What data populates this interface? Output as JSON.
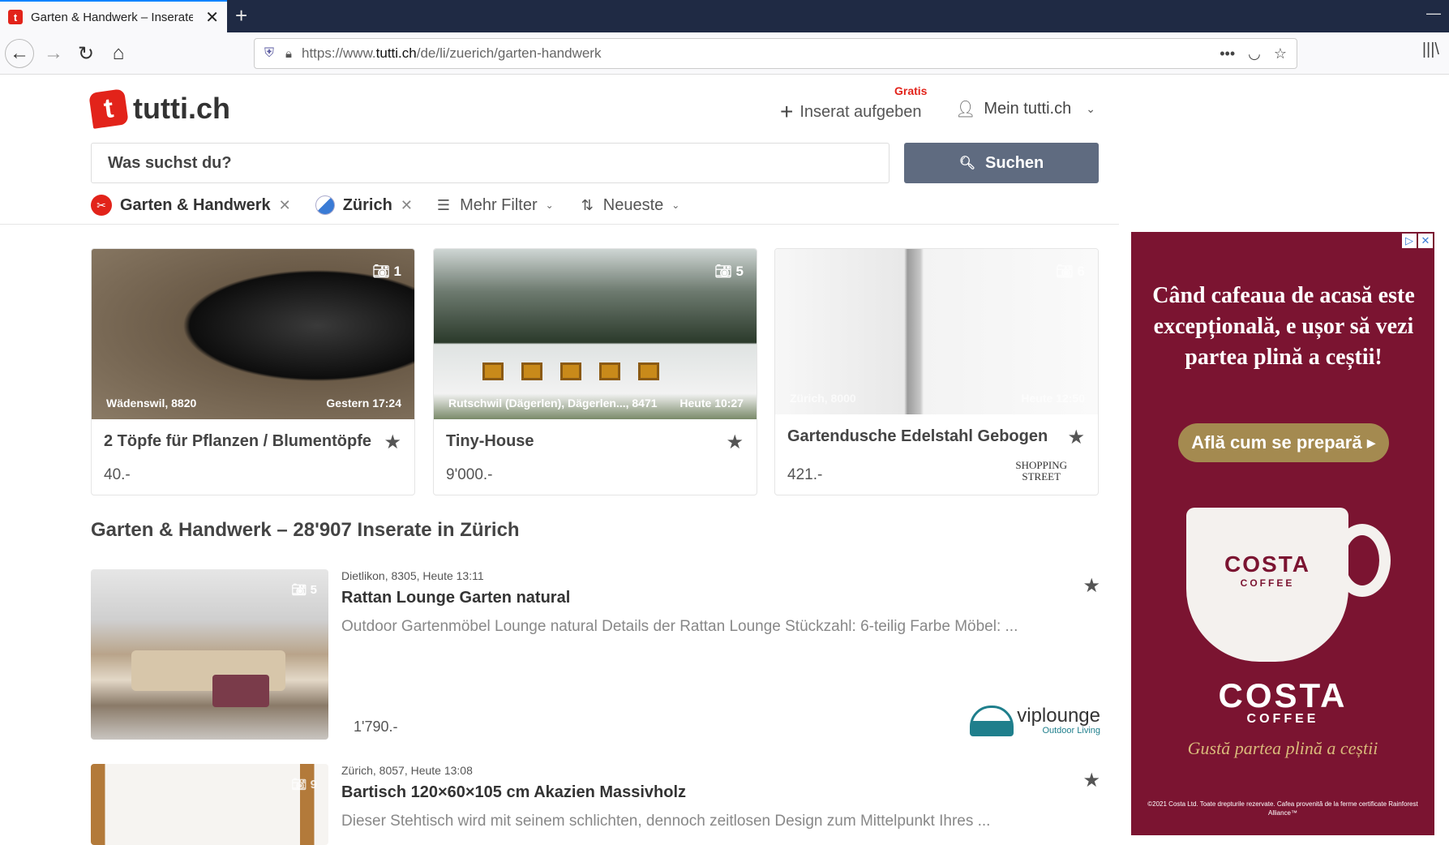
{
  "browser": {
    "tab_title": "Garten & Handwerk – Inserate",
    "url_prefix": "https://www.",
    "url_domain": "tutti.ch",
    "url_path": "/de/li/zuerich/garten-handwerk"
  },
  "header": {
    "logo_text": "tutti.ch",
    "gratis": "Gratis",
    "post_ad": "Inserat aufgeben",
    "account": "Mein tutti.ch"
  },
  "search": {
    "placeholder": "Was suchst du?",
    "button": "Suchen"
  },
  "filters": {
    "category": "Garten & Handwerk",
    "location": "Zürich",
    "more": "Mehr Filter",
    "sort": "Neueste"
  },
  "featured": [
    {
      "photos": "1",
      "location": "Wädenswil, 8820",
      "time": "Gestern 17:24",
      "title": "2 Töpfe für Pflanzen / Blumentöpfe",
      "price": "40.-"
    },
    {
      "photos": "5",
      "location": "Rutschwil (Dägerlen), Dägerlen..., 8471",
      "time": "Heute 10:27",
      "title": "Tiny-House",
      "price": "9'000.-"
    },
    {
      "photos": "6",
      "location": "Zürich, 8000",
      "time": "Heute 12:50",
      "title": "Gartendusche Edelstahl Gebogen",
      "price": "421.-",
      "seller_line1": "SHOPPING",
      "seller_line2": "STREET"
    }
  ],
  "section_title": "Garten & Handwerk – 28'907 Inserate in Zürich",
  "listings": [
    {
      "photos": "5",
      "meta": "Dietlikon, 8305, Heute 13:11",
      "title": "Rattan Lounge Garten natural",
      "description": "Outdoor Gartenmöbel Lounge natural Details der Rattan Lounge Stückzahl: 6-teilig Farbe Möbel: ...",
      "price": "1'790.-",
      "brand": "viplounge",
      "brand_sub": "Outdoor Living"
    },
    {
      "photos": "9",
      "meta": "Zürich, 8057, Heute 13:08",
      "title": "Bartisch 120×60×105 cm Akazien Massivholz",
      "description": "Dieser Stehtisch wird mit seinem schlichten, dennoch zeitlosen Design zum Mittelpunkt Ihres ..."
    }
  ],
  "ad": {
    "headline": "Când cafeaua de acasă este excepțională, e ușor să vezi partea plină a ceștii!",
    "cta": "Află cum se prepară ▸",
    "cup_brand": "COSTA",
    "cup_sub": "COFFEE",
    "brand": "COSTA",
    "brand_sub": "COFFEE",
    "tagline": "Gustă partea plină a ceștii",
    "fine_print": "©2021 Costa Ltd. Toate drepturile rezervate. Cafea provenită de la ferme certificate Rainforest Alliance™"
  }
}
